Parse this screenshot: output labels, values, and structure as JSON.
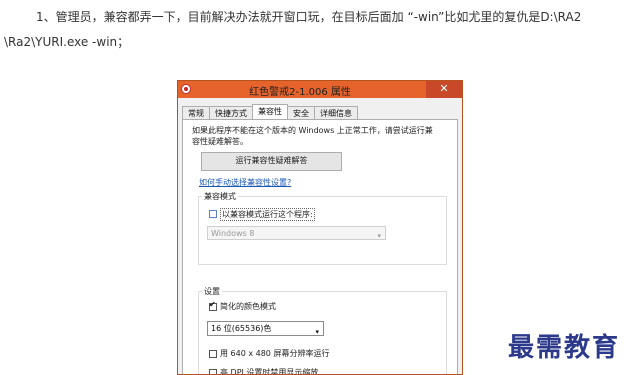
{
  "article": {
    "line1": "1、管理员，兼容都弄一下，目前解决办法就开窗口玩，在目标后面加 “-win”比如尤里的复仇是D:\\RA2",
    "line2": "\\Ra2\\YURI.exe -win；"
  },
  "dialog": {
    "title": "红色警戒2-1.006 属性",
    "close_label": "✕",
    "tabs": [
      "常规",
      "快捷方式",
      "兼容性",
      "安全",
      "详细信息"
    ],
    "active_tab": "兼容性",
    "intro_line1": "如果此程序不能在这个版本的 Windows 上正常工作，请尝试运行兼",
    "intro_line2": "容性疑难解答。",
    "troubleshooter_button": "运行兼容性疑难解答",
    "manual_link": "如何手动选择兼容性设置?",
    "compat_mode": {
      "heading": "兼容模式",
      "checkbox_label": "以兼容模式运行这个程序:",
      "checked": false,
      "os_value": "Windows 8"
    },
    "settings": {
      "heading": "设置",
      "reduced_color_label": "简化的颜色模式",
      "reduced_color_checked": true,
      "color_value": "16 位(65536)色",
      "res_640_label": "用 640 x 480 屏幕分辨率运行",
      "res_640_checked": false,
      "dpi_label": "高 DPI 设置时禁用显示缩放",
      "dpi_checked": false
    }
  },
  "watermark": "最需教育"
}
